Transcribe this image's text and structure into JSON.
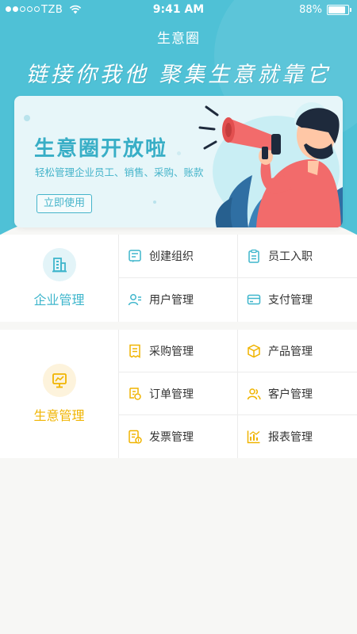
{
  "status_bar": {
    "carrier": "TZB",
    "time": "9:41 AM",
    "battery": "88%",
    "battery_level": 0.88
  },
  "nav": {
    "title": "生意圈"
  },
  "hero": {
    "slogan": "链接你我他  聚集生意就靠它"
  },
  "banner": {
    "title": "生意圈开放啦",
    "subtitle": "轻松管理企业员工、销售、采购、账款",
    "button": "立即使用"
  },
  "sections": {
    "enterprise": {
      "label": "企业管理",
      "color": "#3fb6cc",
      "items": [
        {
          "label": "创建组织",
          "icon": "create-org-icon"
        },
        {
          "label": "员工入职",
          "icon": "clipboard-icon"
        },
        {
          "label": "用户管理",
          "icon": "user-manage-icon"
        },
        {
          "label": "支付管理",
          "icon": "card-icon"
        }
      ]
    },
    "business": {
      "label": "生意管理",
      "color": "#f0b400",
      "items": [
        {
          "label": "采购管理",
          "icon": "receipt-icon"
        },
        {
          "label": "产品管理",
          "icon": "box-icon"
        },
        {
          "label": "订单管理",
          "icon": "order-icon"
        },
        {
          "label": "客户管理",
          "icon": "customers-icon"
        },
        {
          "label": "发票管理",
          "icon": "invoice-icon"
        },
        {
          "label": "报表管理",
          "icon": "report-icon"
        }
      ]
    }
  }
}
